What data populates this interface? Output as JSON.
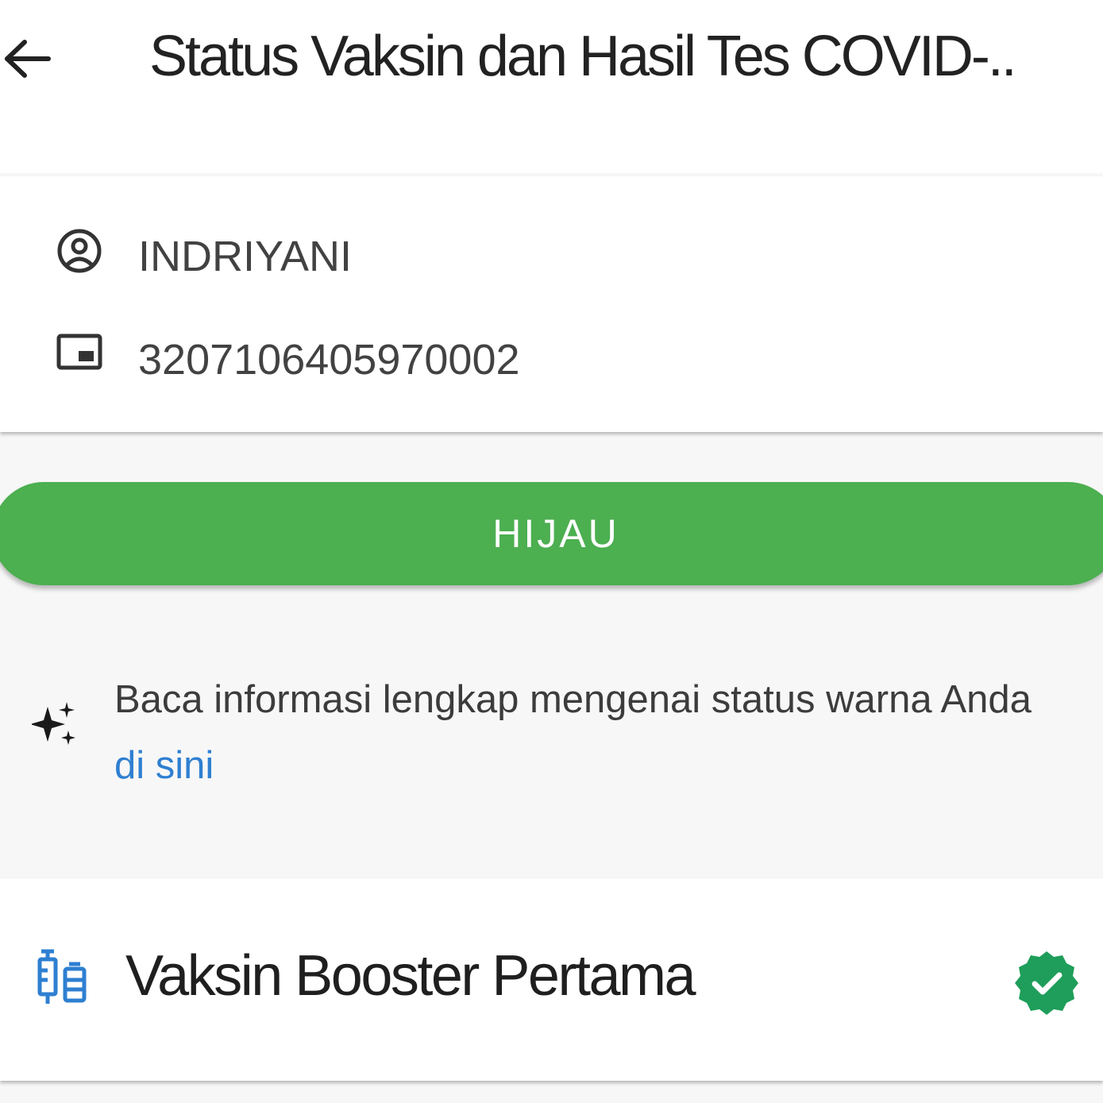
{
  "header": {
    "title": "Status Vaksin dan Hasil Tes COVID-..",
    "back_icon": "arrow-left-icon"
  },
  "identity": {
    "name": "INDRIYANI",
    "name_icon": "user-circle-icon",
    "nik": "3207106405970002",
    "nik_icon": "id-card-icon"
  },
  "status": {
    "label": "HIJAU",
    "color": "#4caf50"
  },
  "info": {
    "icon": "sparkle-icon",
    "text": "Baca informasi lengkap mengenai status warna Anda ",
    "link_label": "di sini",
    "link_color": "#2e7fd1"
  },
  "vaccine": {
    "icon": "vaccine-syringe-icon",
    "title": "Vaksin Booster Pertama",
    "status_icon": "check-badge-icon",
    "status_color": "#1e9e5a"
  }
}
